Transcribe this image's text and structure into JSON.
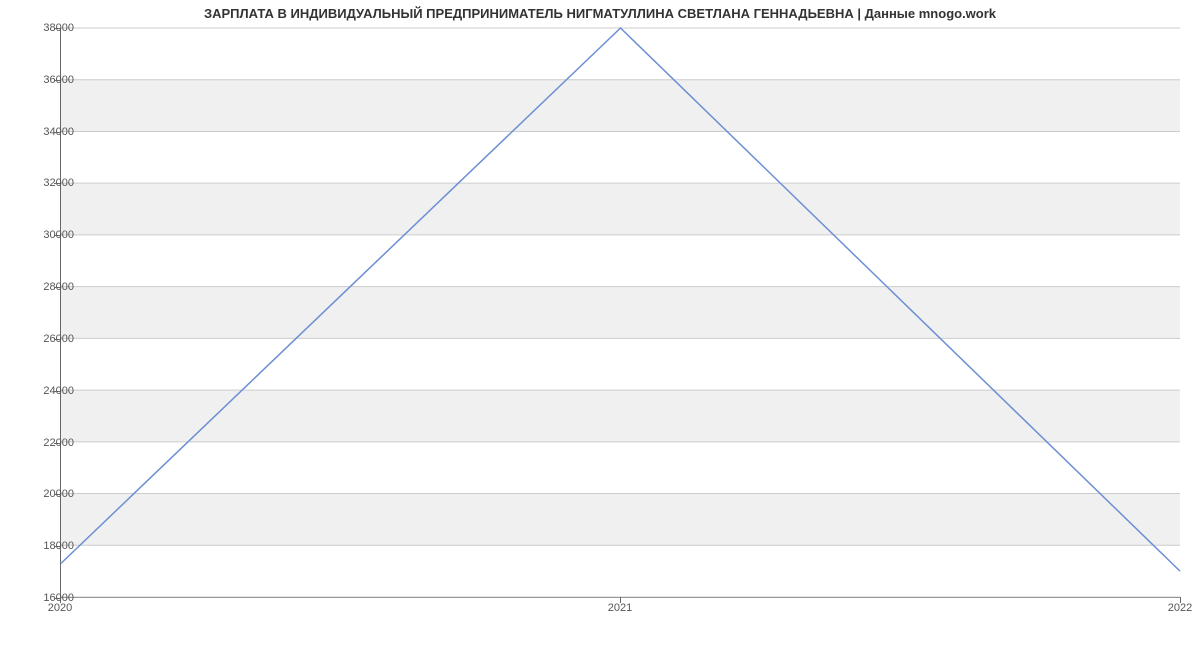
{
  "chart_data": {
    "type": "line",
    "title": "ЗАРПЛАТА В ИНДИВИДУАЛЬНЫЙ ПРЕДПРИНИМАТЕЛЬ НИГМАТУЛЛИНА СВЕТЛАНА ГЕННАДЬЕВНА | Данные mnogo.work",
    "x": [
      2020,
      2021,
      2022
    ],
    "values": [
      17300,
      38000,
      17000
    ],
    "x_ticks": [
      2020,
      2021,
      2022
    ],
    "y_ticks": [
      16000,
      18000,
      20000,
      22000,
      24000,
      26000,
      28000,
      30000,
      32000,
      34000,
      36000,
      38000
    ],
    "xlim": [
      2020,
      2022
    ],
    "ylim": [
      16000,
      38000
    ],
    "xlabel": "",
    "ylabel": ""
  }
}
